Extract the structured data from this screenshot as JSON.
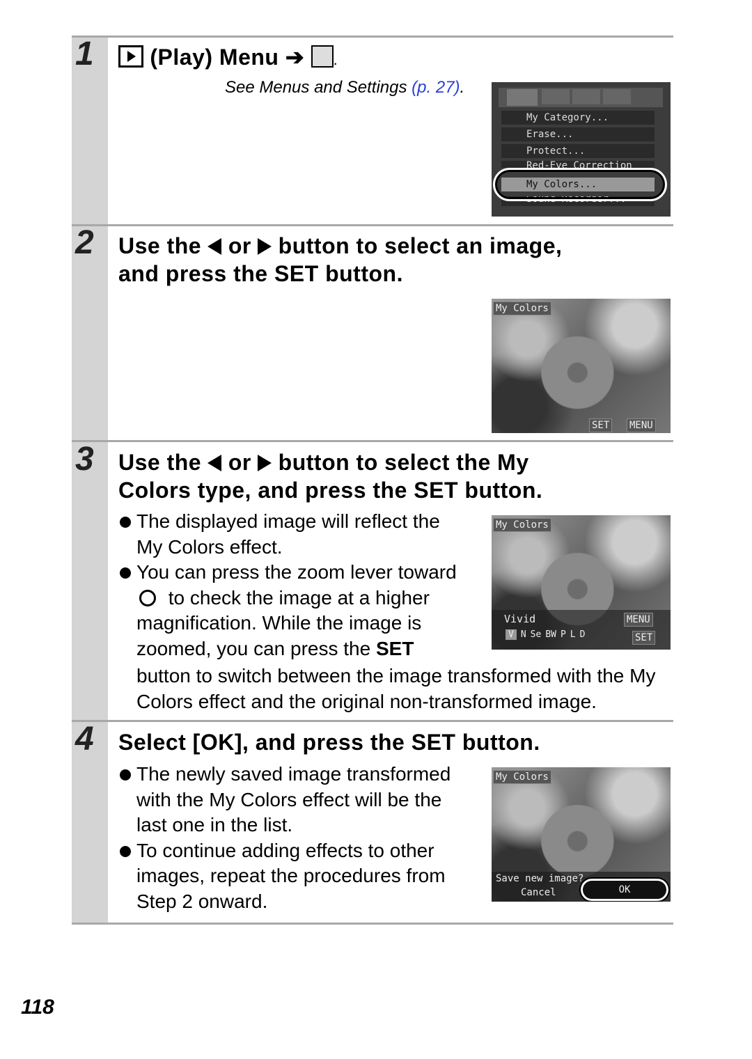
{
  "page_number": "118",
  "steps": [
    {
      "number": "1",
      "title_parts": [
        "(Play) Menu",
        "."
      ],
      "see_text": "See Menus and Settings ",
      "see_link": "(p. 27)",
      "see_end": ".",
      "screen": {
        "menu_items": [
          "My Category...",
          "Erase...",
          "Protect...",
          "Red-Eye Correction",
          "My Colors...",
          "Sound Recorder..."
        ],
        "selected": "My Colors..."
      }
    },
    {
      "number": "2",
      "title": [
        "Use the",
        "or",
        "button to select an image,",
        "and press the ",
        "SET",
        " button."
      ],
      "screen": {
        "label": "My Colors",
        "set": "SET",
        "menu": "MENU"
      }
    },
    {
      "number": "3",
      "title": [
        "Use the",
        "or",
        "button to select the My",
        "Colors type, and press the ",
        "SET",
        " button."
      ],
      "bullets": [
        "The displayed image will reflect the My Colors effect.",
        "You can press the zoom lever toward"
      ],
      "b2_rest": " to check the image at a higher magnification. While the image is zoomed, you can press the ",
      "b2_set": "SET",
      "b2_tail": "button to switch between the image transformed with the My Colors effect and the original non-transformed image.",
      "screen": {
        "label": "My Colors",
        "mode": "Vivid",
        "menu": "MENU",
        "set": "SET",
        "modes": [
          "V",
          "N",
          "Se",
          "BW",
          "P",
          "L",
          "D"
        ]
      }
    },
    {
      "number": "4",
      "title": [
        "Select [OK], and press the ",
        "SET",
        " button."
      ],
      "bullets": [
        "The newly saved image transformed with the My Colors effect will be the last one in the list.",
        "To continue adding effects to other images, repeat the procedures from Step 2 onward."
      ],
      "screen": {
        "label": "My Colors",
        "prompt": "Save new image?",
        "cancel": "Cancel",
        "ok": "OK"
      }
    }
  ],
  "colors": {
    "link": "#2b3fd8",
    "gutter": "#d4d4d4"
  }
}
